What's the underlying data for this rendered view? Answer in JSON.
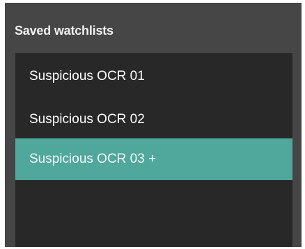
{
  "panel": {
    "title": "Saved watchlists",
    "items": [
      {
        "label": "Suspicious OCR 01",
        "selected": false
      },
      {
        "label": "Suspicious OCR 02",
        "selected": false
      },
      {
        "label": "Suspicious OCR 03 +",
        "selected": true
      }
    ]
  },
  "colors": {
    "panel_background": "#464646",
    "list_background": "#282828",
    "selected_background": "#50a79b",
    "text": "#ffffff"
  }
}
